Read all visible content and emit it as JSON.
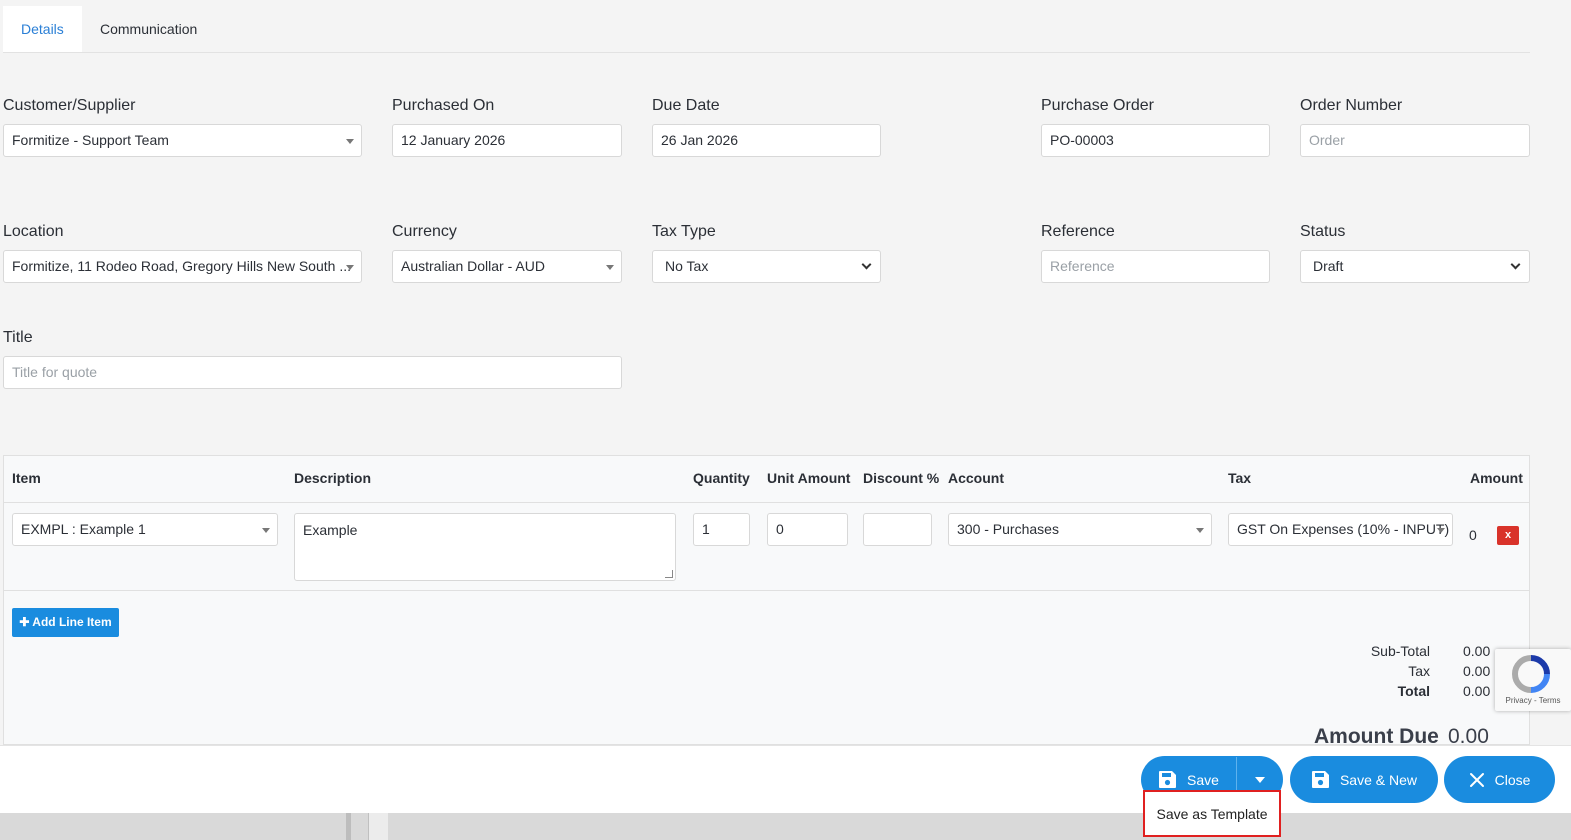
{
  "tabs": [
    {
      "label": "Details",
      "active": true
    },
    {
      "label": "Communication",
      "active": false
    }
  ],
  "form": {
    "customer_label": "Customer/Supplier",
    "customer_value": "Formitize - Support Team",
    "purchased_label": "Purchased On",
    "purchased_value": "12 January 2026",
    "due_label": "Due Date",
    "due_value": "26 Jan 2026",
    "po_label": "Purchase Order",
    "po_value": "PO-00003",
    "order_label": "Order Number",
    "order_placeholder": "Order",
    "location_label": "Location",
    "location_value": "Formitize, 11 Rodeo Road, Gregory Hills New South ...",
    "currency_label": "Currency",
    "currency_value": "Australian Dollar - AUD",
    "taxtype_label": "Tax Type",
    "taxtype_value": "No Tax",
    "reference_label": "Reference",
    "reference_placeholder": "Reference",
    "status_label": "Status",
    "status_value": "Draft",
    "title_label": "Title",
    "title_placeholder": "Title for quote"
  },
  "table": {
    "headers": {
      "item": "Item",
      "description": "Description",
      "quantity": "Quantity",
      "unit_amount": "Unit Amount",
      "discount": "Discount %",
      "account": "Account",
      "tax": "Tax",
      "amount": "Amount"
    },
    "rows": [
      {
        "item": "EXMPL : Example 1",
        "description": "Example",
        "quantity": "1",
        "unit_amount": "0",
        "discount": "",
        "account": "300 - Purchases",
        "tax": "GST On Expenses (10% - INPUT)",
        "amount": "0",
        "delete": "x"
      }
    ],
    "add_line": "Add Line Item"
  },
  "totals": {
    "subtotal_label": "Sub-Total",
    "subtotal_value": "0.00",
    "tax_label": "Tax",
    "tax_value": "0.00",
    "total_label": "Total",
    "total_value": "0.00",
    "amount_due_label": "Amount Due",
    "amount_due_value": "0.00"
  },
  "captcha": {
    "links": "Privacy - Terms",
    "icon": "recaptcha-icon"
  },
  "footer": {
    "save_label": "Save",
    "save_new_label": "Save & New",
    "close_label": "Close",
    "save_as_template_label": "Save as Template"
  },
  "colors": {
    "accent": "#1a8cdf",
    "danger": "#d9332a",
    "highlight": "#e02020",
    "tab_active_text": "#2a7fd6"
  }
}
